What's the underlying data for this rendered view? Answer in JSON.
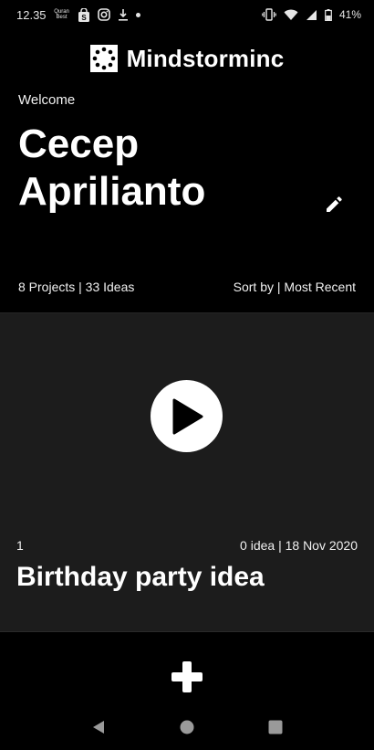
{
  "status_bar": {
    "time": "12.35",
    "quran_icon_text": "Quran Best",
    "battery": "41%"
  },
  "header": {
    "app_title": "Mindstorminc"
  },
  "profile": {
    "welcome": "Welcome",
    "name": "Cecep Aprilianto",
    "stats": "8 Projects | 33 Ideas",
    "sort_label": "Sort by | Most Recent"
  },
  "projects": [
    {
      "number": "1",
      "meta": "0 idea | 18 Nov 2020",
      "title": "Birthday party idea"
    }
  ],
  "icons": {
    "edit": "pencil-icon",
    "play": "play-icon",
    "add": "plus-icon",
    "nav_back": "triangle-back-icon",
    "nav_home": "circle-home-icon",
    "nav_recents": "square-recents-icon"
  },
  "colors": {
    "background": "#000000",
    "card": "#1c1c1c",
    "text": "#ffffff"
  }
}
